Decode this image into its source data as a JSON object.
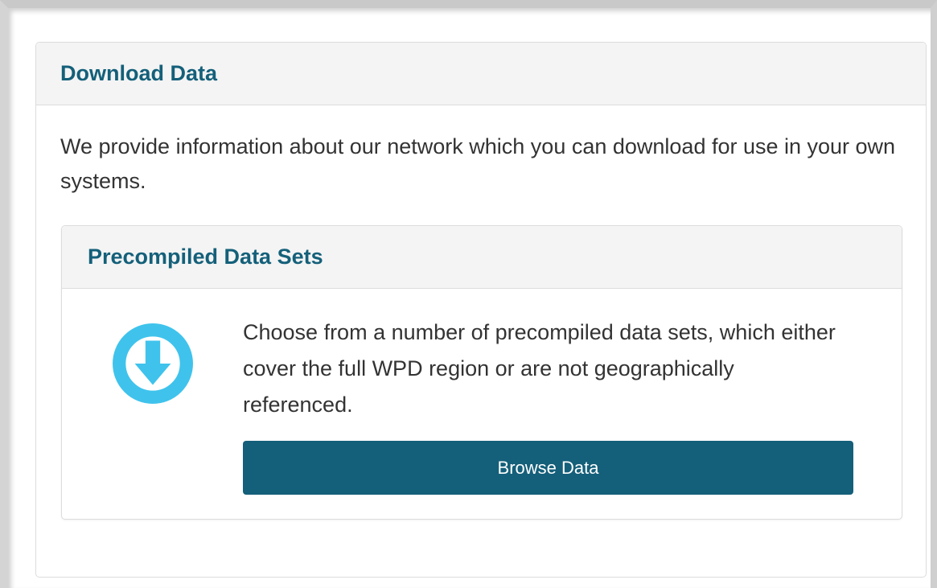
{
  "panel": {
    "title": "Download Data",
    "intro": "We provide information about our network which you can download for use in your own systems."
  },
  "dataset_panel": {
    "title": "Precompiled Data Sets",
    "icon": "download-circle-icon",
    "description": "Choose from a number of precompiled data sets, which either cover the full WPD region or are not geographically referenced.",
    "button_label": "Browse Data"
  },
  "colors": {
    "heading_text": "#14607a",
    "button_bg": "#145f7a",
    "icon_color": "#3fc3ec",
    "body_text": "#333333"
  }
}
